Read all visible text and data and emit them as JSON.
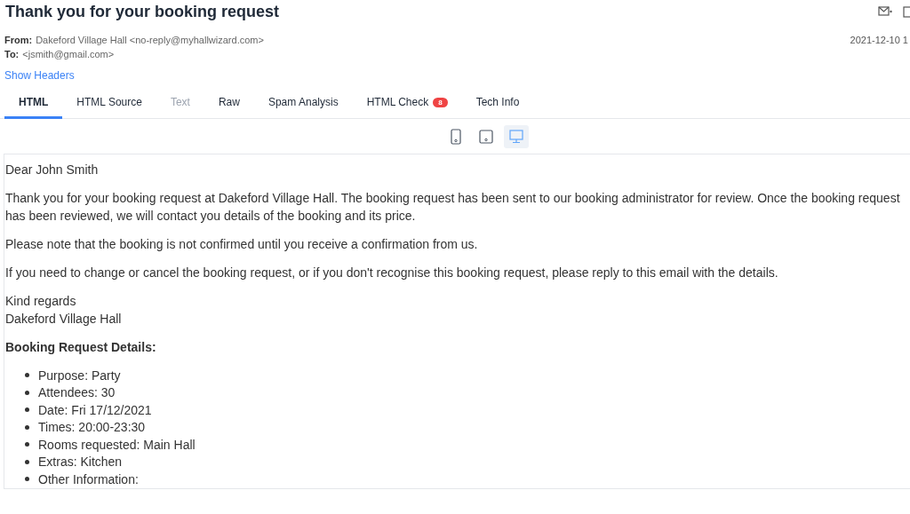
{
  "title": "Thank you for your booking request",
  "header": {
    "from_label": "From:",
    "from": "Dakeford Village Hall <no-reply@myhallwizard.com>",
    "to_label": "To:",
    "to": "<jsmith@gmail.com>",
    "date": "2021-12-10 1",
    "show_headers": "Show Headers"
  },
  "tabs": [
    {
      "label": "HTML",
      "selected": true,
      "disabled": false
    },
    {
      "label": "HTML Source",
      "selected": false,
      "disabled": false
    },
    {
      "label": "Text",
      "selected": false,
      "disabled": true
    },
    {
      "label": "Raw",
      "selected": false,
      "disabled": false
    },
    {
      "label": "Spam Analysis",
      "selected": false,
      "disabled": false
    },
    {
      "label": "HTML Check",
      "selected": false,
      "disabled": false,
      "badge": "8"
    },
    {
      "label": "Tech Info",
      "selected": false,
      "disabled": false
    }
  ],
  "devices": [
    {
      "kind": "phone",
      "selected": false
    },
    {
      "kind": "tablet",
      "selected": false
    },
    {
      "kind": "desktop",
      "selected": true
    }
  ],
  "body": {
    "paragraphs": [
      "Dear John Smith",
      "Thank you for your booking request at Dakeford Village Hall. The booking request has been sent to our booking administrator for review. Once the booking request has been reviewed, we will contact you details of the booking and its price.",
      "Please note that the booking is not confirmed until you receive a confirmation from us.",
      "If you need to change or cancel the booking request, or if you don't recognise this booking request, please reply to this email with the details."
    ],
    "signoff": [
      "Kind regards",
      "Dakeford Village Hall"
    ],
    "details_heading": "Booking Request Details:",
    "details": [
      "Purpose: Party",
      "Attendees: 30",
      "Date: Fri 17/12/2021",
      "Times: 20:00-23:30",
      "Rooms requested: Main Hall",
      "Extras: Kitchen",
      "Other Information:"
    ]
  }
}
